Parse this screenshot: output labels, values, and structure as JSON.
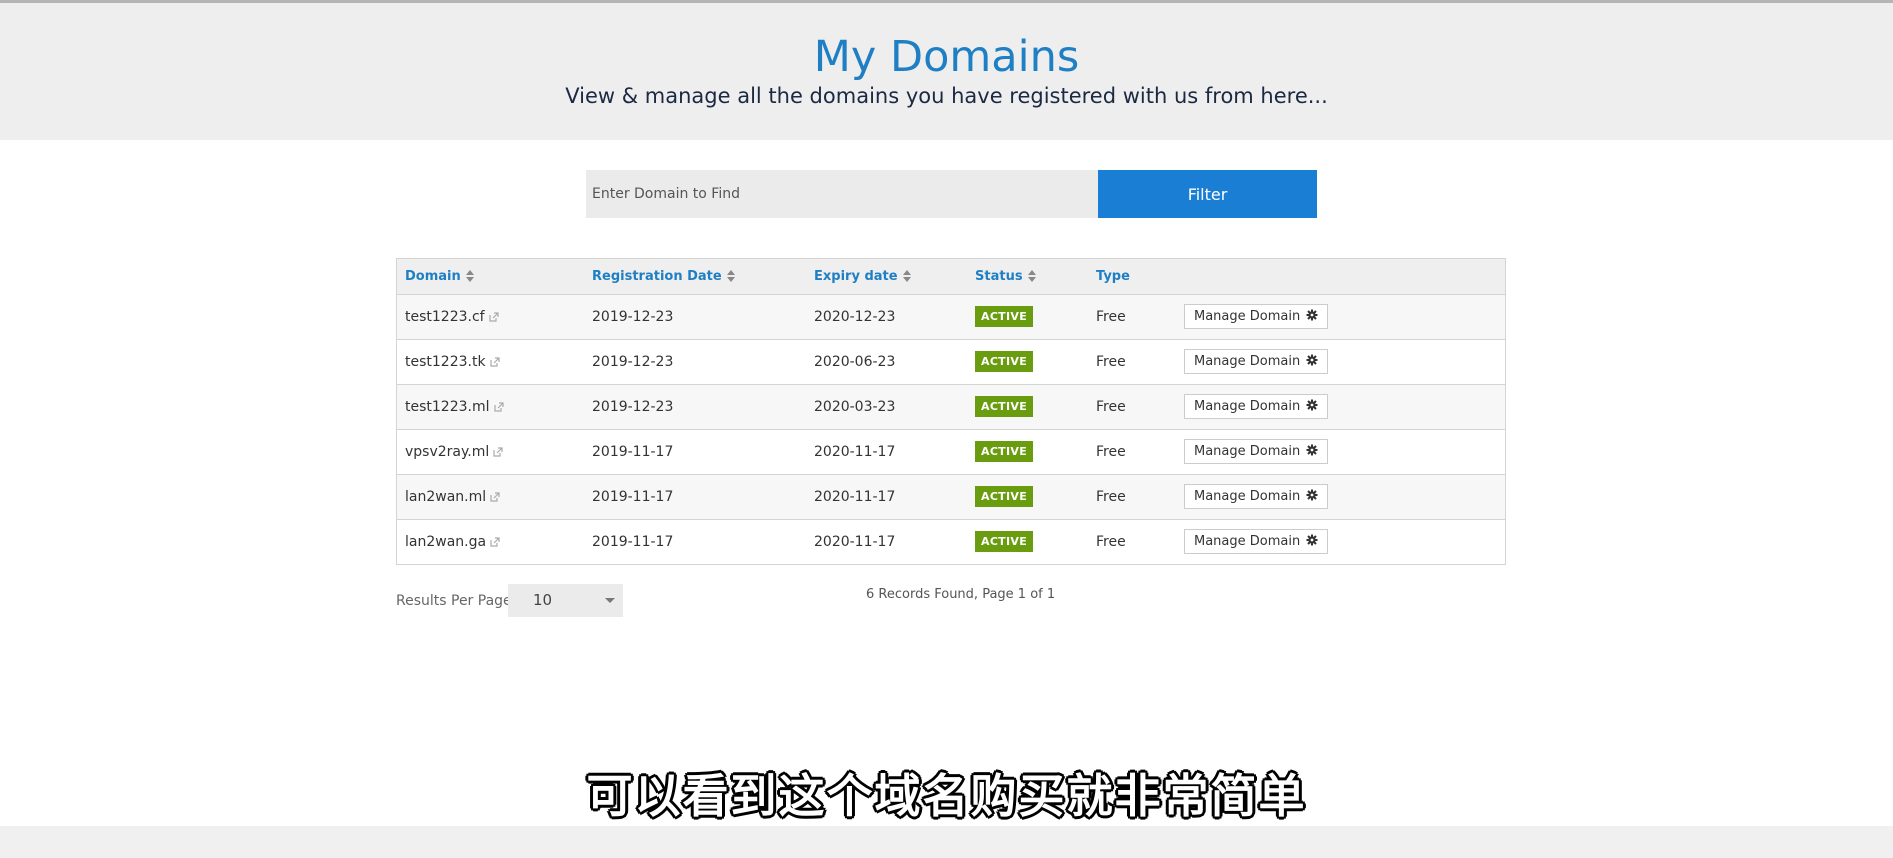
{
  "header": {
    "title": "My Domains",
    "subtitle": "View & manage all the domains you have registered with us from here..."
  },
  "search": {
    "placeholder": "Enter Domain to Find",
    "button_label": "Filter"
  },
  "table": {
    "columns": {
      "domain": "Domain",
      "registration_date": "Registration Date",
      "expiry_date": "Expiry date",
      "status": "Status",
      "type": "Type"
    },
    "rows": [
      {
        "domain": "test1223.cf",
        "registration_date": "2019-12-23",
        "expiry_date": "2020-12-23",
        "status": "ACTIVE",
        "type": "Free",
        "action": "Manage Domain"
      },
      {
        "domain": "test1223.tk",
        "registration_date": "2019-12-23",
        "expiry_date": "2020-06-23",
        "status": "ACTIVE",
        "type": "Free",
        "action": "Manage Domain"
      },
      {
        "domain": "test1223.ml",
        "registration_date": "2019-12-23",
        "expiry_date": "2020-03-23",
        "status": "ACTIVE",
        "type": "Free",
        "action": "Manage Domain"
      },
      {
        "domain": "vpsv2ray.ml",
        "registration_date": "2019-11-17",
        "expiry_date": "2020-11-17",
        "status": "ACTIVE",
        "type": "Free",
        "action": "Manage Domain"
      },
      {
        "domain": "lan2wan.ml",
        "registration_date": "2019-11-17",
        "expiry_date": "2020-11-17",
        "status": "ACTIVE",
        "type": "Free",
        "action": "Manage Domain"
      },
      {
        "domain": "lan2wan.ga",
        "registration_date": "2019-11-17",
        "expiry_date": "2020-11-17",
        "status": "ACTIVE",
        "type": "Free",
        "action": "Manage Domain"
      }
    ]
  },
  "footer": {
    "results_per_page_label": "Results Per Page:",
    "results_per_page_value": "10",
    "records_text": "6 Records Found, Page 1 of 1"
  },
  "caption": "可以看到这个域名购买就非常简单",
  "colors": {
    "accent": "#1a7fd4",
    "title": "#1f7fc4",
    "status_active": "#6a9c10"
  }
}
